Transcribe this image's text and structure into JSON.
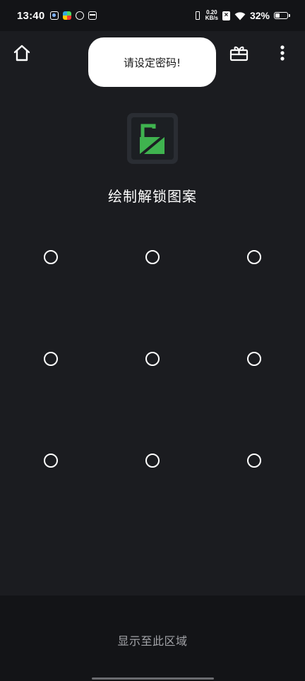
{
  "status_bar": {
    "time": "13:40",
    "net_speed_value": "0.20",
    "net_speed_unit": "KB/s",
    "battery_percent_label": "32%",
    "battery_level": 0.32,
    "left_icons": [
      "weather-icon",
      "app-store-icon",
      "link-icon",
      "calendar-icon"
    ],
    "right_icons": [
      "vibrate-icon",
      "no-sim-icon",
      "wifi-icon",
      "battery-icon"
    ]
  },
  "top_bar": {
    "home_icon": "home-icon",
    "gift_icon": "gift-icon",
    "more_icon": "more-vertical-icon"
  },
  "toast": {
    "message": "请设定密码!"
  },
  "app_logo": {
    "icon": "lock-logo-icon",
    "colors": {
      "tile": "#2a2d33",
      "square": "#1c1f23",
      "green": "#3fb34f"
    }
  },
  "pattern": {
    "title": "绘制解锁图案",
    "rows": 3,
    "columns": 3
  },
  "bottom": {
    "label": "显示至此区域"
  },
  "colors": {
    "background": "#1b1c20",
    "status_bar": "#131417",
    "bottom_panel": "#131417",
    "accent_green": "#3fb34f",
    "muted_text": "#a3a4a8"
  }
}
